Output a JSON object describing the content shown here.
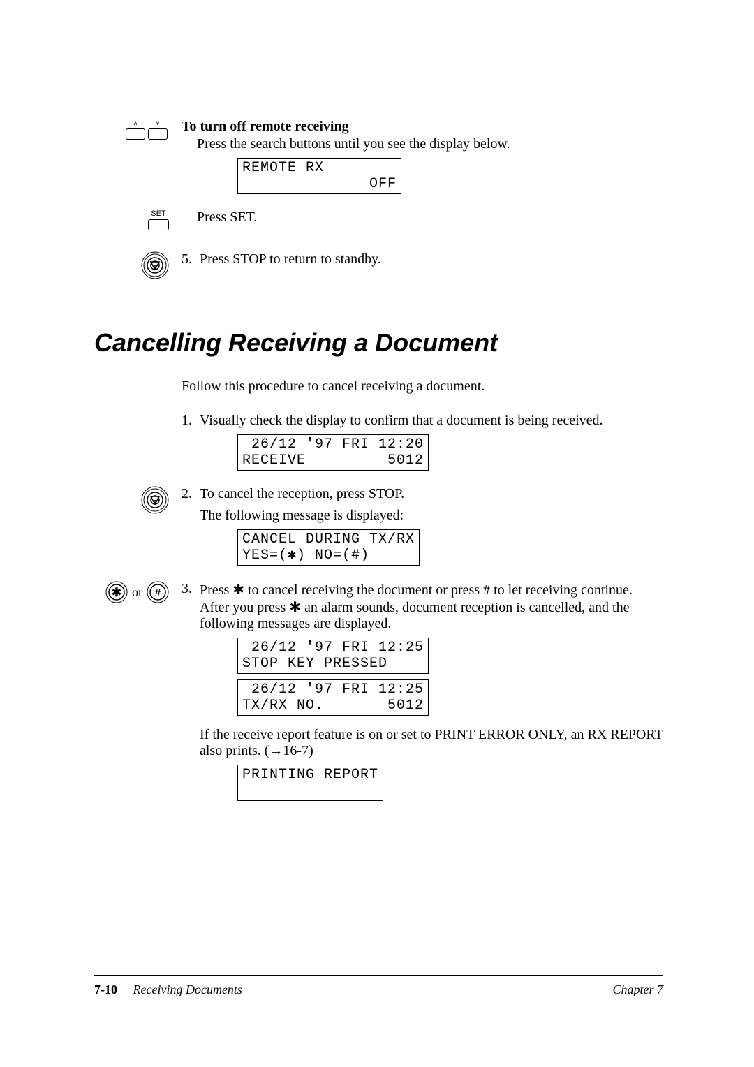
{
  "section1": {
    "subhead": "To turn off remote receiving",
    "press_search": "Press the search buttons until you see the display below.",
    "lcd_remote_line1": "REMOTE RX",
    "lcd_remote_line2": "              OFF",
    "press_set": "Press SET.",
    "step5_num": "5.",
    "step5_text": "Press STOP to return to standby.",
    "key_up_label": "∧",
    "key_down_label": "∨",
    "set_label": "SET"
  },
  "section2": {
    "title": "Cancelling Receiving a Document",
    "intro": "Follow this procedure to cancel receiving a document.",
    "step1_num": "1.",
    "step1_text": "Visually check the display to confirm that a document is being received.",
    "lcd1_line1": " 26/12 '97 FRI 12:20",
    "lcd1_line2": "RECEIVE         5012",
    "step2_num": "2.",
    "step2_text": "To cancel the reception, press STOP.",
    "step2_sub": "The following message is displayed:",
    "lcd2_line1": "CANCEL DURING TX/RX",
    "lcd2_line2": "YES=(✱) NO=(#)",
    "step3_num": "3.",
    "step3_text": "Press ✱ to cancel receiving the document or press # to let receiving continue. After you press ✱ an alarm sounds, document reception is cancelled, and the following messages are displayed.",
    "lcd3_line1": " 26/12 '97 FRI 12:25",
    "lcd3_line2": "STOP KEY PRESSED",
    "lcd4_line1": " 26/12 '97 FRI 12:25",
    "lcd4_line2": "TX/RX NO.       5012",
    "step3_note": "If the receive report feature is on or set to PRINT ERROR ONLY, an RX REPORT also prints. (→16-7)",
    "lcd5_line1": "PRINTING REPORT",
    "lcd5_line2": " ",
    "or_label": "or"
  },
  "footer": {
    "page_num": "7-10",
    "doc_title": "Receiving Documents",
    "chapter": "Chapter 7"
  }
}
